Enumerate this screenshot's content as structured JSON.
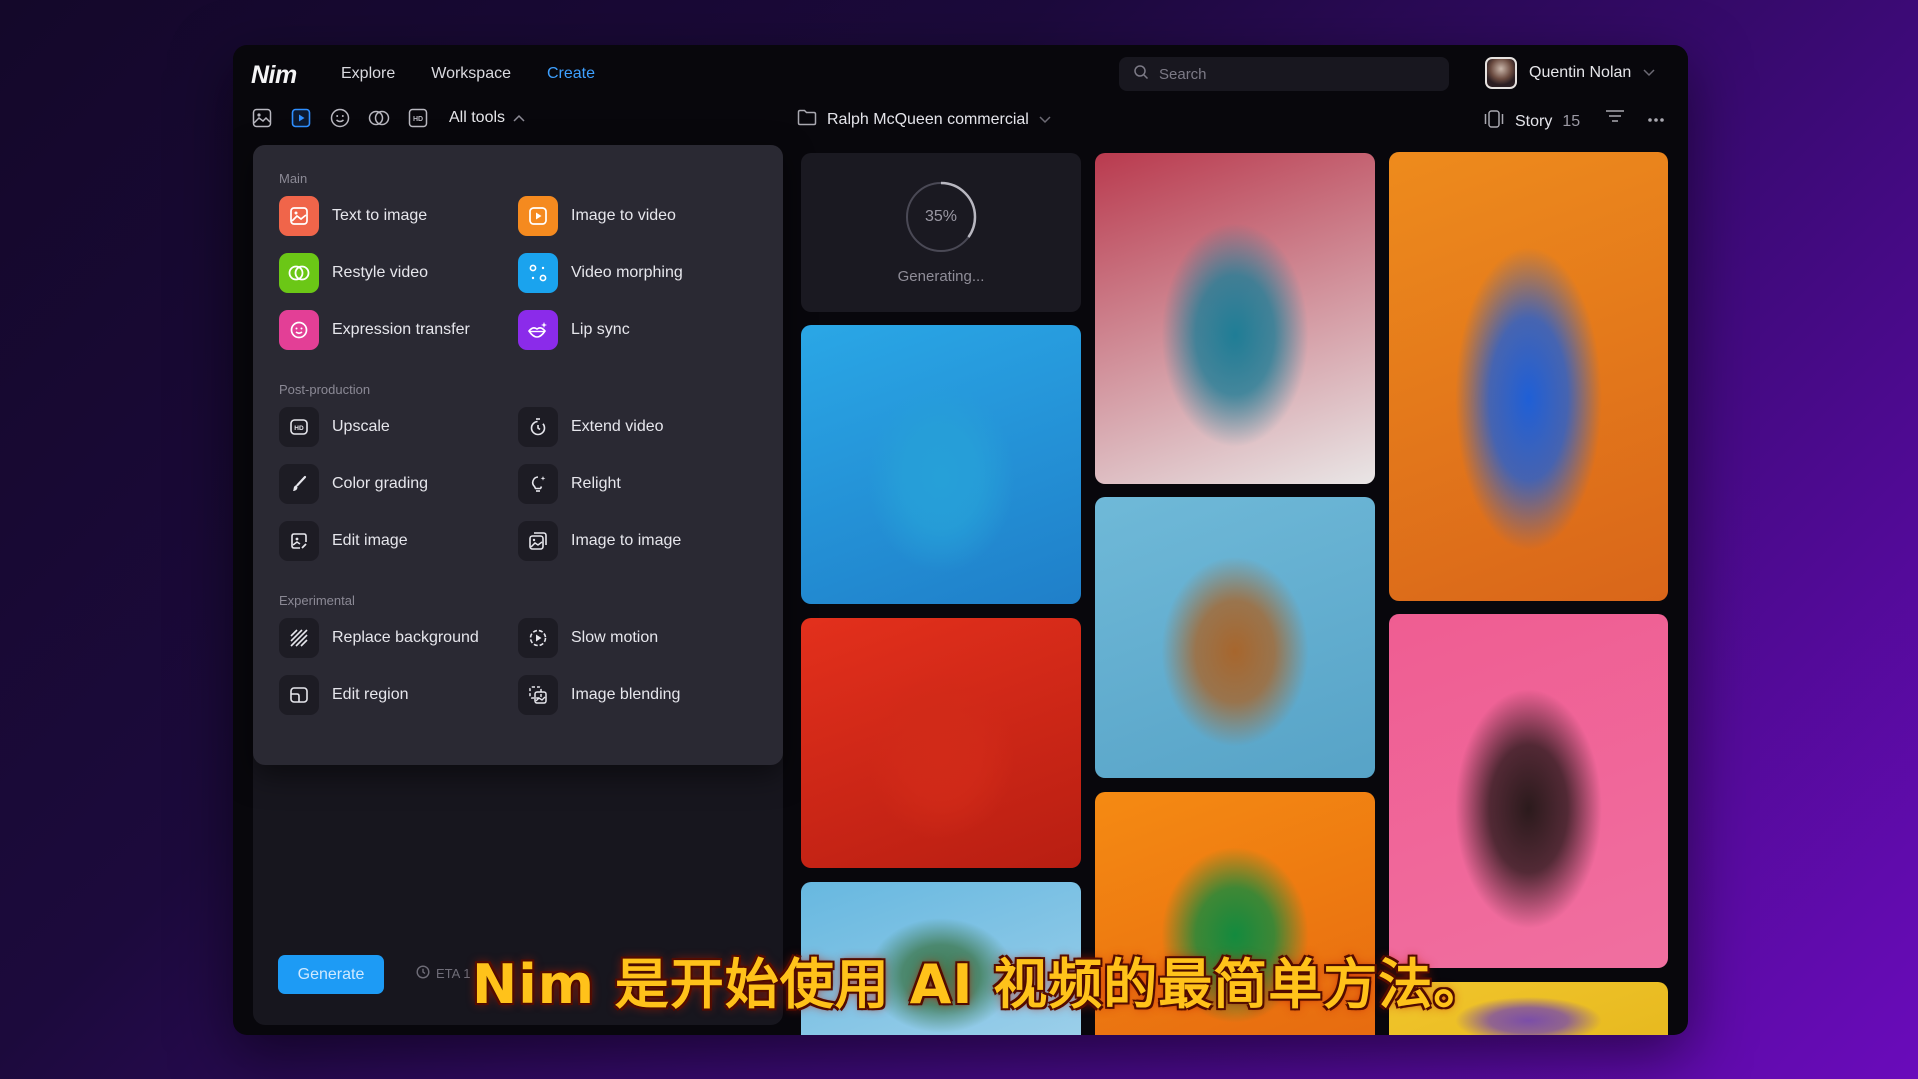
{
  "header": {
    "logo": "Nim",
    "nav": [
      {
        "label": "Explore",
        "active": false
      },
      {
        "label": "Workspace",
        "active": false
      },
      {
        "label": "Create",
        "active": true
      }
    ],
    "search_placeholder": "Search",
    "user_name": "Quentin Nolan"
  },
  "toolbar": {
    "icons": [
      "image-icon",
      "video-icon",
      "face-icon",
      "blend-icon",
      "hd-icon"
    ],
    "active_icon": "video-icon",
    "all_tools_label": "All tools",
    "project_name": "Ralph McQueen commercial",
    "story_label": "Story",
    "story_count": "15"
  },
  "menu": {
    "sections": [
      {
        "title": "Main",
        "items": [
          {
            "label": "Text to image",
            "icon": "text-to-image-icon",
            "color": "#f0654a"
          },
          {
            "label": "Image to video",
            "icon": "image-to-video-icon",
            "color": "#f58a1f"
          },
          {
            "label": "Restyle video",
            "icon": "restyle-video-icon",
            "color": "#6bc716"
          },
          {
            "label": "Video morphing",
            "icon": "video-morphing-icon",
            "color": "#1aa3ee"
          },
          {
            "label": "Expression transfer",
            "icon": "expression-transfer-icon",
            "color": "#e33f96"
          },
          {
            "label": "Lip sync",
            "icon": "lip-sync-icon",
            "color": "#8b2bea"
          }
        ]
      },
      {
        "title": "Post-production",
        "items": [
          {
            "label": "Upscale",
            "icon": "hd-upscale-icon"
          },
          {
            "label": "Extend video",
            "icon": "extend-video-icon"
          },
          {
            "label": "Color grading",
            "icon": "brush-icon"
          },
          {
            "label": "Relight",
            "icon": "lightbulb-icon"
          },
          {
            "label": "Edit image",
            "icon": "edit-image-icon"
          },
          {
            "label": "Image to image",
            "icon": "image-to-image-icon"
          }
        ]
      },
      {
        "title": "Experimental",
        "items": [
          {
            "label": "Replace background",
            "icon": "hatch-background-icon"
          },
          {
            "label": "Slow motion",
            "icon": "slow-motion-icon"
          },
          {
            "label": "Edit region",
            "icon": "edit-region-icon"
          },
          {
            "label": "Image blending",
            "icon": "image-blending-icon"
          }
        ]
      }
    ]
  },
  "generate": {
    "button_label": "Generate",
    "eta_label": "ETA 1"
  },
  "gallery": {
    "progress_percent": 35,
    "progress_label": "35%",
    "status_text": "Generating...",
    "images": [
      {
        "name": "man-with-suitcase",
        "colors": [
          "#2aa7e6",
          "#1f7fc9",
          "#26a0d8"
        ]
      },
      {
        "name": "cyclist-with-umbrella",
        "colors": [
          "#e3301c",
          "#b81e12",
          "#d12a18"
        ]
      },
      {
        "name": "beach-volleyball",
        "colors": [
          "#67b8e0",
          "#9ed0ea",
          "#3f7a52"
        ]
      },
      {
        "name": "cat-with-sunglasses",
        "colors": [
          "#b93a4e",
          "#e9e6e6",
          "#1f7d96"
        ]
      },
      {
        "name": "shoes-on-pedestals",
        "colors": [
          "#6fb9d8",
          "#57a3c7",
          "#a7662d"
        ]
      },
      {
        "name": "dancing-man",
        "colors": [
          "#f58a12",
          "#e66a10",
          "#138a3e"
        ]
      },
      {
        "name": "woman-in-blue-dress",
        "colors": [
          "#ee8b1c",
          "#d9661a",
          "#1f5fd6"
        ]
      },
      {
        "name": "makeup-portrait",
        "colors": [
          "#ef5d92",
          "#f06fa0",
          "#2b1a1c"
        ]
      },
      {
        "name": "band-on-yellow",
        "colors": [
          "#f1c52c",
          "#e6b81e",
          "#7b4ea8"
        ]
      }
    ]
  },
  "subtitle": "Nim 是开始使用 AI 视频的最简单方法。"
}
